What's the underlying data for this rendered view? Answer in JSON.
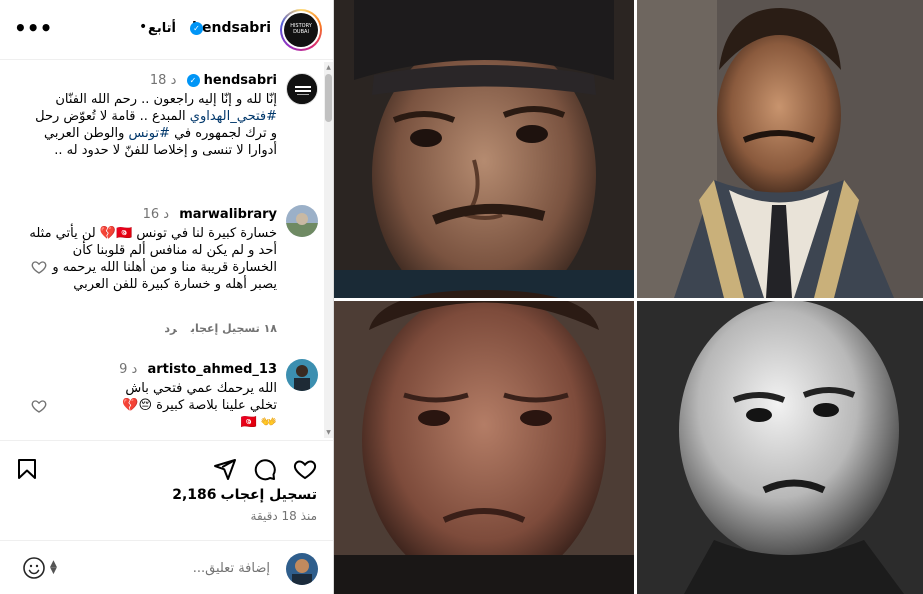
{
  "header": {
    "username": "hendsabri",
    "follow_label": "أتابع",
    "separator": "•",
    "avatar_text": "HISTORY DUBAI"
  },
  "comments": [
    {
      "username": "hendsabri",
      "time": "18 د",
      "verified": true,
      "text_parts": [
        "إنّا لله و إنّا إليه راجعون .. رحم الله الفنّان ",
        "#فتحي_الهداوي",
        " المبدع .. قامة لا تُعوّض رحل و ترك لجمهوره في ",
        "#تونس",
        " والوطن العربي أدوارا لا تنسى و إخلاصا للفنّ لا حدود له .."
      ]
    },
    {
      "username": "marwalibrary",
      "time": "16 د",
      "text": "خسارة كبيرة لنا في تونس 🇹🇳💔 لن يأتي مثله أحد و لم يكن له منافس ألم قلوبنا كأن الخسارة قريبة منا و من أهلنا الله يرحمه و يصبر أهله و خسارة كبيرة للفن العربي",
      "likes": "١٨ تسجيل إعجاب",
      "reply": "رد"
    },
    {
      "username": "artisto_ahmed_13",
      "time": "9 د",
      "text": "الله يرحمك عمي فتحي باش تخلي علينا بلاصة كبيرة 😔💔👐 🇹🇳"
    }
  ],
  "actions": {
    "likes_count": "2,186",
    "likes_label": "تسجيل إعجاب",
    "time_ago": "منذ 18 دقيقة"
  },
  "add_comment": {
    "placeholder": "إضافة تعليق..."
  },
  "icons": [
    "more-icon",
    "heart-icon",
    "comment-icon",
    "share-icon",
    "bookmark-icon",
    "emoji-icon",
    "verified-icon"
  ],
  "colors": {
    "link": "#00376b",
    "verified": "#0095f6",
    "muted": "#737373",
    "border": "#dbdbdb"
  }
}
